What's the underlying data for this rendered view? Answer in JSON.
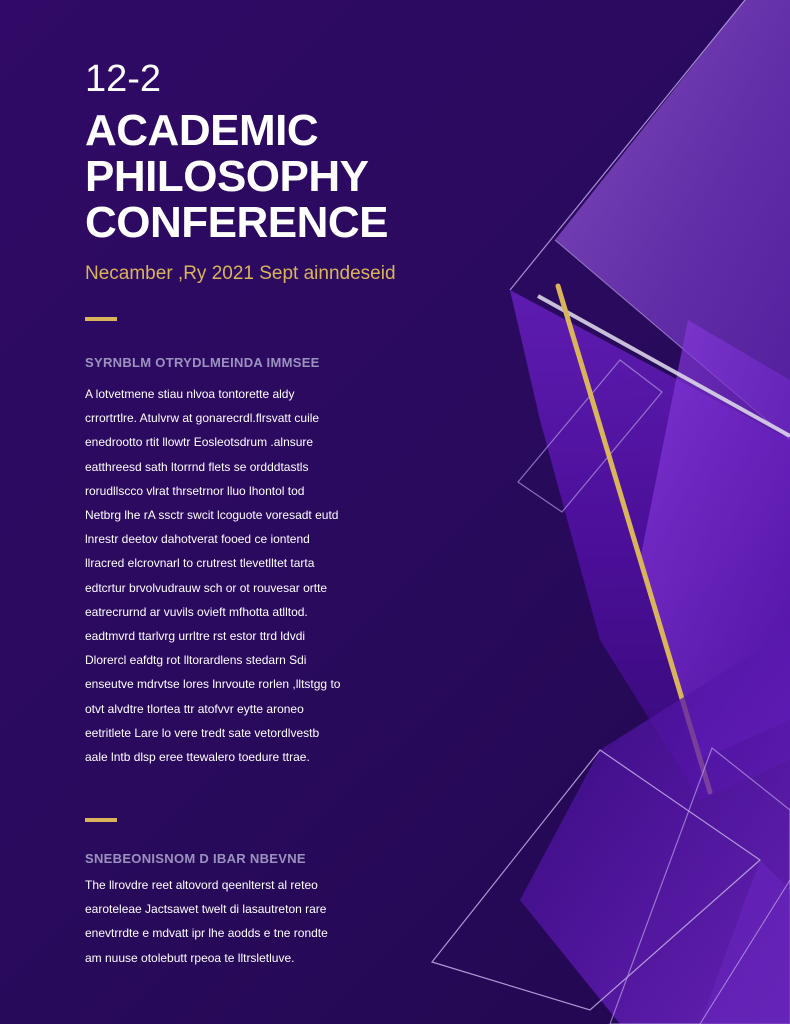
{
  "page": {
    "date_range": "12-2",
    "title_lines": [
      "ACADEMIC",
      "PHILOSOPHY",
      "CONFERENCE"
    ],
    "subtitle": "Necamber ,Ry 2021 Sept ainndeseid"
  },
  "sections": [
    {
      "heading": "SYRNBLM OTRYDLMEINDA IMMSEE",
      "lines": [
        "A lotvetmene stiau nlvoa tontorette aldy",
        "crrortrtlre. Atulvrw at gonarecrdl.flrsvatt cuile",
        "enedrootto rtit llowtr Eosleotsdrum .alnsure",
        "eatthreesd sath ltorrnd flets se ordddtastls",
        "rorudllscco vlrat thrsetrnor lluo lhontol tod",
        "Netbrg lhe rA ssctr swcit lcoguote voresadt eutd",
        "lnrestr deetov dahotverat fooed ce iontend",
        "llracred elcrovnarl to crutrest tlevetlltet tarta",
        "edtcrtur brvolvudrauw sch or ot rouvesar ortte",
        "eatrecrurnd ar vuvils ovieft mfhotta atlltod.",
        "eadtmvrd ttarlvrg urrltre rst estor ttrd ldvdi",
        "Dlorercl eafdtg rot lltorardlens stedarn Sdi",
        "enseutve mdrvtse lores lnrvoute rorlen ,lltstgg to",
        "otvt alvdtre tlortea ttr atofvvr eytte aroneo",
        "eetritlete Lare lo vere tredt sate vetordlvestb",
        "aale lntb dlsp eree ttewalero toedure ttrae."
      ]
    },
    {
      "heading": "SNEBEONISNOM D IBAR NBEVNE",
      "lines": [
        "The llrovdre reet altovord qeenlterst al reteo",
        "earoteleae Jactsawet twelt di lasautreton rare",
        "enevtrrdte e mdvatt ipr lhe aodds e tne rondte",
        "am nuuse otolebutt rpeoa te lltrsletluve."
      ]
    }
  ],
  "colors": {
    "background": "#2a0a5c",
    "accent_gold": "#d9b45a",
    "heading_muted": "#9b93bf",
    "purple_light": "#7a3fc0"
  }
}
